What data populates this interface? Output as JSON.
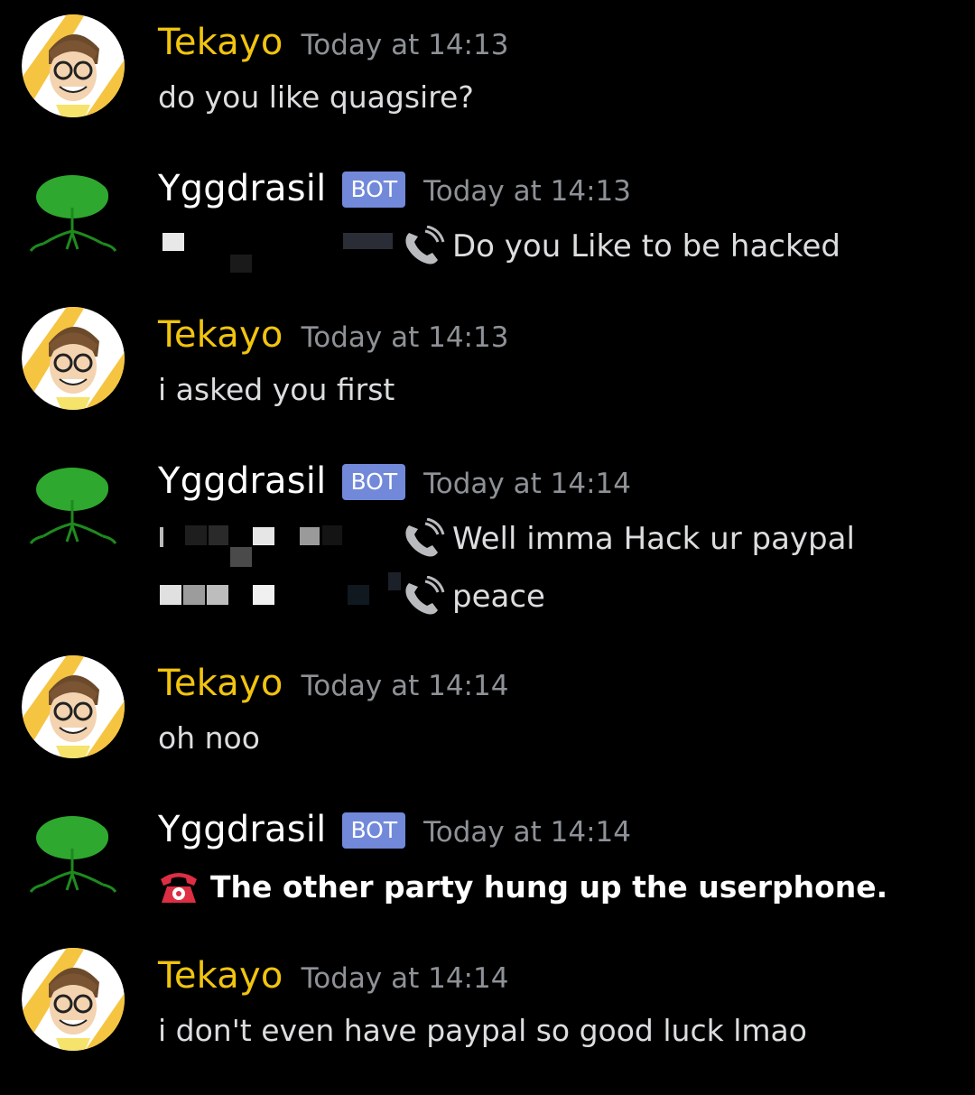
{
  "messages": [
    {
      "author": "Tekayo",
      "timestamp": "Today at 14:13",
      "text": "do you like quagsire?"
    },
    {
      "author": "Yggdrasil",
      "badge": "BOT",
      "timestamp": "Today at 14:13",
      "lines": [
        "Do you Like to be hacked"
      ]
    },
    {
      "author": "Tekayo",
      "timestamp": "Today at 14:13",
      "text": "i asked you first"
    },
    {
      "author": "Yggdrasil",
      "badge": "BOT",
      "timestamp": "Today at 14:14",
      "lines": [
        "Well imma Hack ur paypal",
        "peace"
      ]
    },
    {
      "author": "Tekayo",
      "timestamp": "Today at 14:14",
      "text": "oh noo"
    },
    {
      "author": "Yggdrasil",
      "badge": "BOT",
      "timestamp": "Today at 14:14",
      "text": "The other party hung up the userphone."
    },
    {
      "author": "Tekayo",
      "timestamp": "Today at 14:14",
      "text": "i don't even have paypal so good luck lmao"
    }
  ],
  "colors": {
    "background": "#000000",
    "user_name": "#f1c40f",
    "bot_badge": "#7289da",
    "timestamp": "#8e9297",
    "message_text": "#dcddde",
    "phone_icon": "#b9bbbe",
    "hangup_icon": "#dd2e44"
  },
  "icons": [
    "user-avatar",
    "tree-avatar",
    "telephone-receiver-icon",
    "telephone-icon"
  ]
}
